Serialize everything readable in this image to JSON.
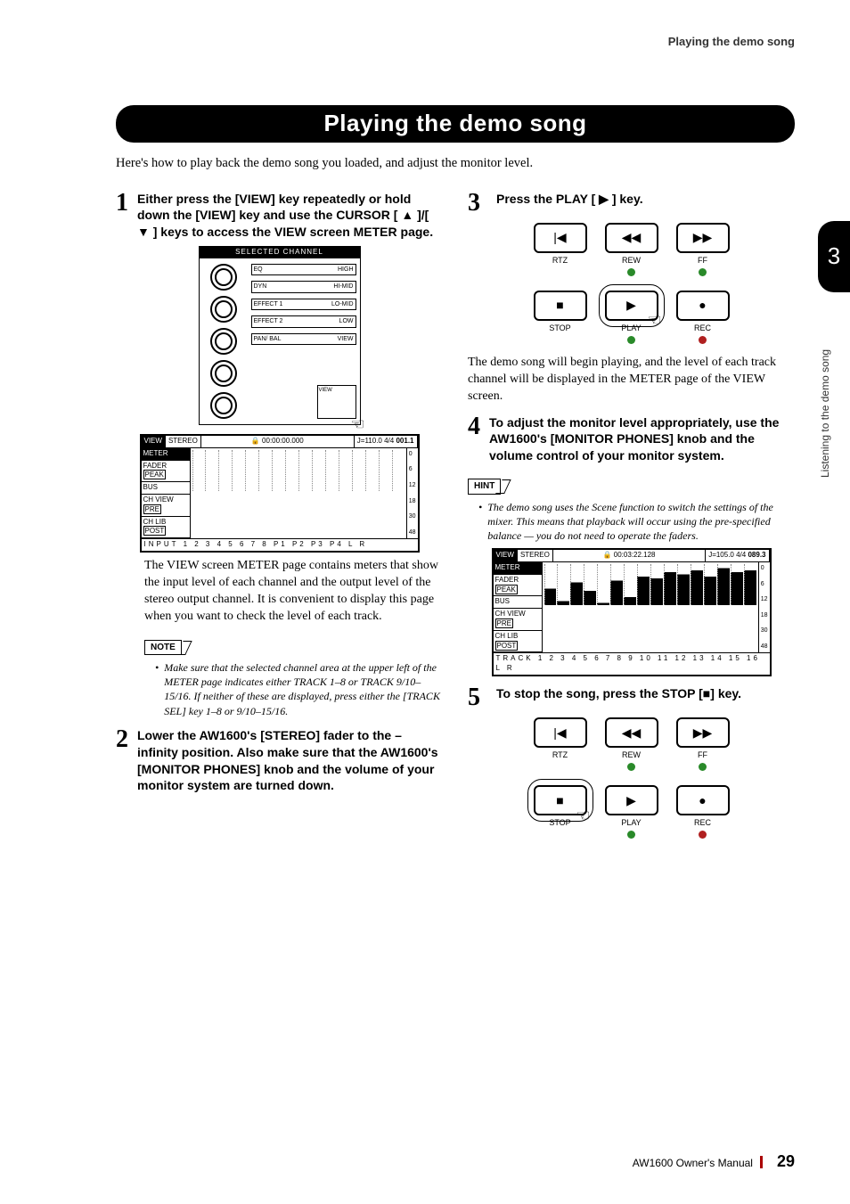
{
  "header": {
    "running": "Playing the demo song"
  },
  "title": "Playing the demo song",
  "intro": "Here's how to play back the demo song you loaded, and adjust the monitor level.",
  "tab": {
    "num": "3",
    "text": "Listening to the demo song"
  },
  "footer": {
    "manual": "AW1600  Owner's Manual",
    "page": "29"
  },
  "steps": {
    "s1": {
      "num": "1",
      "head": "Either press the [VIEW] key repeatedly or hold down the [VIEW] key and use the CURSOR [ ▲ ]/[ ▼ ] keys to access the VIEW screen METER page.",
      "body": "The VIEW screen METER page contains meters that show the input level of each channel and the output level of the stereo output channel. It is convenient to display this page when you want to check the level of each track.",
      "note_label": "NOTE",
      "note": "Make sure that the selected channel area at the upper left of the METER page indicates either TRACK 1–8 or TRACK 9/10–15/16. If neither of these are displayed, press either the [TRACK SEL] key 1–8 or 9/10–15/16."
    },
    "s2": {
      "num": "2",
      "head": "Lower the AW1600's [STEREO] fader to the – infinity position. Also make sure that the AW1600's [MONITOR PHONES] knob and the volume of your monitor system are turned down."
    },
    "s3": {
      "num": "3",
      "head": "Press the PLAY [ ▶ ] key.",
      "body": "The demo song will begin playing, and the level of each track channel will be displayed in the METER page of the VIEW screen."
    },
    "s4": {
      "num": "4",
      "head": "To adjust the monitor level appropriately, use the AW1600's [MONITOR PHONES] knob and the volume control of your monitor system.",
      "hint_label": "HINT",
      "hint": "The demo song uses the Scene function to switch the settings of the mixer. This means that playback will occur using the pre-specified balance — you do not need to operate the faders."
    },
    "s5": {
      "num": "5",
      "head": "To stop the song, press the STOP [■] key."
    }
  },
  "transport": {
    "rtz": {
      "glyph": "|◀",
      "label": "RTZ"
    },
    "rew": {
      "glyph": "◀◀",
      "label": "REW"
    },
    "ff": {
      "glyph": "▶▶",
      "label": "FF"
    },
    "stop": {
      "glyph": "■",
      "label": "STOP"
    },
    "play": {
      "glyph": "▶",
      "label": "PLAY"
    },
    "rec": {
      "glyph": "●",
      "label": "REC"
    }
  },
  "strip": {
    "title": "SELECTED CHANNEL",
    "rows": [
      "EQ",
      "DYN",
      "EFFECT 1",
      "EFFECT 2",
      "PAN/ BAL"
    ],
    "bands": [
      "HIGH",
      "HI-MID",
      "LO-MID",
      "LOW",
      "VIEW"
    ]
  },
  "meter1": {
    "tabs": [
      "VIEW",
      "STEREO"
    ],
    "time": "00:00:00.000",
    "tempo": "J=110.0 4/4",
    "meas": "001.1",
    "side": [
      "METER",
      "FADER",
      "BUS",
      "CH VIEW",
      "CH LIB"
    ],
    "pills": [
      "PEAK",
      "PRE",
      "POST"
    ],
    "foot": "INPUT  1  2  3  4  5  6  7  8  P1  P2  P3  P4  L R",
    "scale": [
      "0",
      "6",
      "12",
      "18",
      "30",
      "48"
    ]
  },
  "meter2": {
    "tabs": [
      "VIEW",
      "STEREO"
    ],
    "time": "00:03:22.128",
    "tempo": "J=105.0 4/4",
    "meas": "089.3",
    "side": [
      "METER",
      "FADER",
      "BUS",
      "CH VIEW",
      "CH LIB"
    ],
    "pills": [
      "PEAK",
      "PRE",
      "POST"
    ],
    "foot": "TRACK 1  2  3  4  5  6  7  8  9 10 11 12 13 14 15 16  L R",
    "scale": [
      "0",
      "6",
      "12",
      "18",
      "30",
      "48"
    ]
  }
}
